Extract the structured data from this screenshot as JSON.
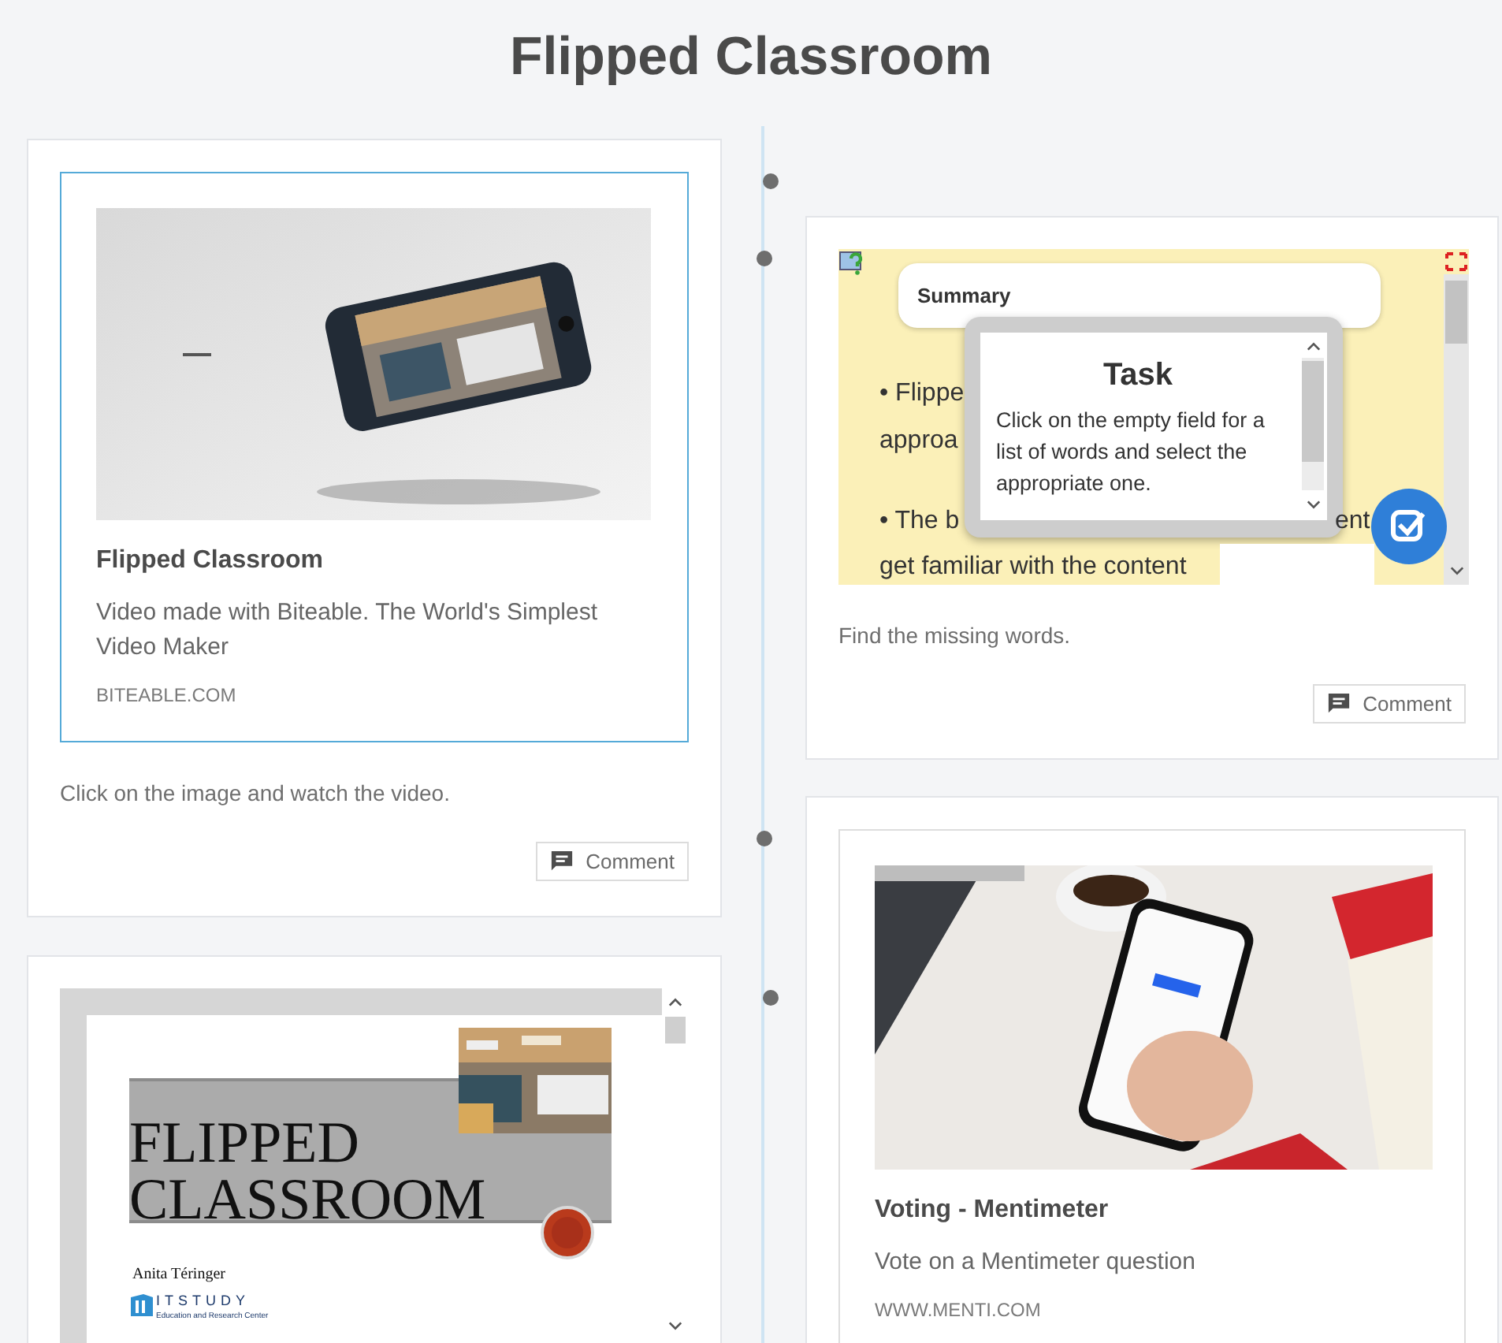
{
  "title": "Flipped Classroom",
  "posts": [
    {
      "kind": "link",
      "link": {
        "title": "Flipped Classroom",
        "description": "Video made with Biteable. The World's Simplest Video Maker",
        "domain": "BITEABLE.COM",
        "highlighted": true,
        "kind": "picture"
      },
      "caption": "Click on the image and watch the video.",
      "comment_label": "Comment"
    },
    {
      "kind": "quiz",
      "embed": {
        "summary_heading": "Summary",
        "text_fragments": [
          "• Flippe",
          "approa",
          "• The b",
          "ent"
        ],
        "text_line": "get familiar with the content",
        "task": {
          "title": "Task",
          "body": "Click on the empty field for a list of words and select the appropriate one."
        }
      },
      "caption": "Find the missing words.",
      "comment_label": "Comment"
    },
    {
      "kind": "slides",
      "slide": {
        "title_lines": [
          "FLIPPED",
          "CLASSROOM"
        ],
        "author": "Anita Téringer",
        "logo_text": "ITSTUDY",
        "logo_subtitle": "Education and Research Center"
      }
    },
    {
      "kind": "link",
      "link": {
        "title": "Voting - Mentimeter",
        "description": "Vote on a Mentimeter question",
        "domain": "WWW.MENTI.COM",
        "highlighted": false,
        "kind": "picture"
      }
    }
  ]
}
